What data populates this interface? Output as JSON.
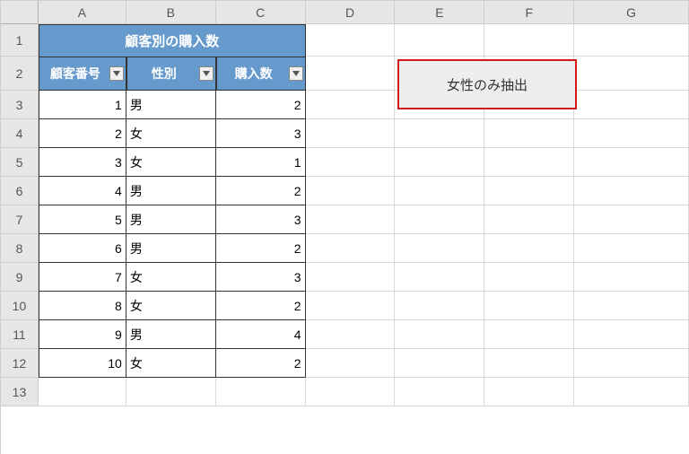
{
  "columns": [
    "A",
    "B",
    "C",
    "D",
    "E",
    "F",
    "G"
  ],
  "row_count": 13,
  "table": {
    "title": "顧客別の購入数",
    "headers": [
      "顧客番号",
      "性別",
      "購入数"
    ],
    "rows": [
      {
        "id": 1,
        "gender": "男",
        "qty": 2
      },
      {
        "id": 2,
        "gender": "女",
        "qty": 3
      },
      {
        "id": 3,
        "gender": "女",
        "qty": 1
      },
      {
        "id": 4,
        "gender": "男",
        "qty": 2
      },
      {
        "id": 5,
        "gender": "男",
        "qty": 3
      },
      {
        "id": 6,
        "gender": "男",
        "qty": 2
      },
      {
        "id": 7,
        "gender": "女",
        "qty": 3
      },
      {
        "id": 8,
        "gender": "女",
        "qty": 2
      },
      {
        "id": 9,
        "gender": "男",
        "qty": 4
      },
      {
        "id": 10,
        "gender": "女",
        "qty": 2
      }
    ]
  },
  "button": {
    "label": "女性のみ抽出"
  },
  "row_heights": {
    "1": 36,
    "2": 38,
    "default": 32
  }
}
